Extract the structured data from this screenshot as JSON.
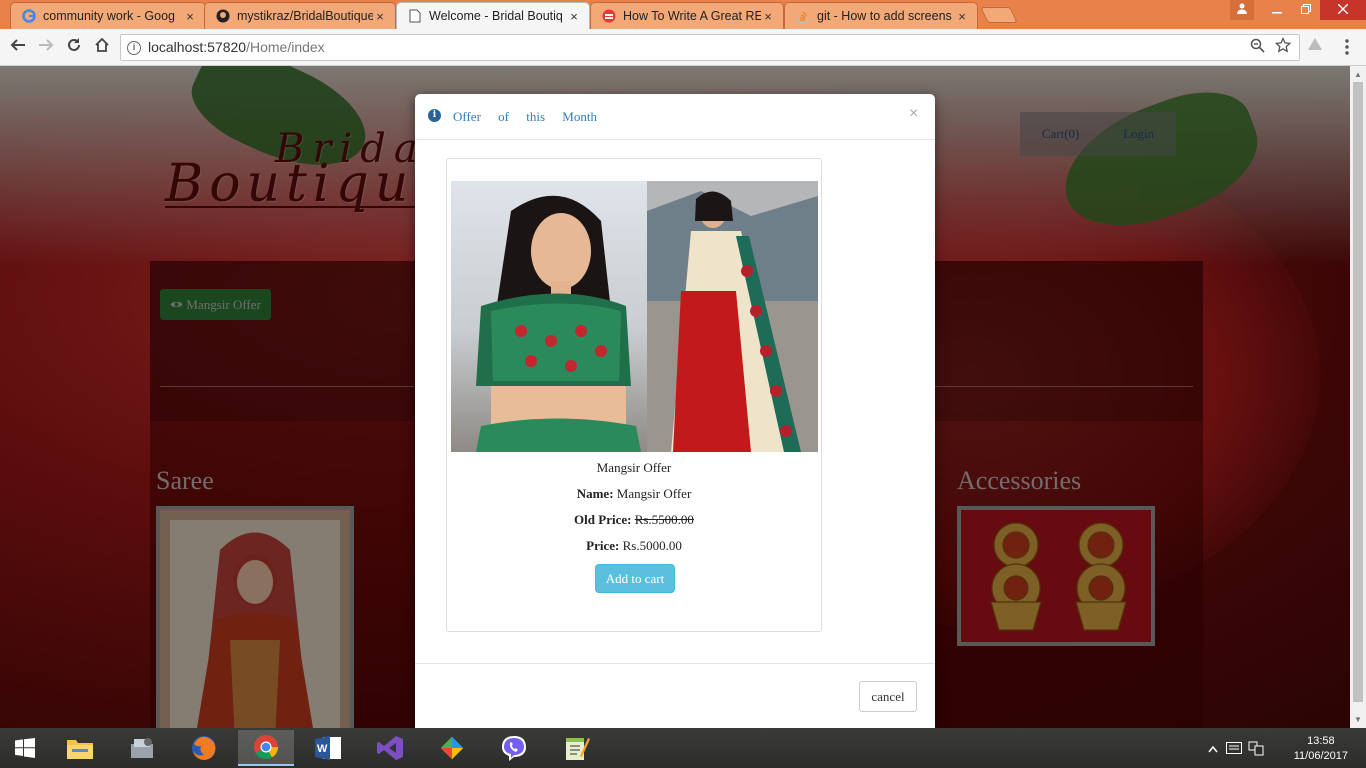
{
  "browser": {
    "tabs": [
      {
        "title": "community work - Goog",
        "icon": "google-icon"
      },
      {
        "title": "mystikraz/BridalBoutique",
        "icon": "github-icon"
      },
      {
        "title": "Welcome - Bridal Boutiq",
        "icon": "page-icon",
        "active": true
      },
      {
        "title": "How To Write A Great RE",
        "icon": "site-icon"
      },
      {
        "title": "git - How to add screens",
        "icon": "stackoverflow-icon"
      }
    ],
    "close_glyph": "×",
    "url_host": "localhost:57820",
    "url_path": "/Home/index"
  },
  "site": {
    "logo_line1": "Bridal",
    "logo_line2": "Boutique",
    "nav": {
      "cart": "Cart(0)",
      "login": "Login"
    },
    "offer_button": "Mangsir Offer",
    "categories": {
      "left": "Saree",
      "right": "Accessories"
    }
  },
  "modal": {
    "title": "Offer of this Month",
    "close": "×",
    "product": {
      "name_caption": "Mangsir Offer",
      "name_label": "Name:",
      "name_value": "Mangsir Offer",
      "old_price_label": "Old Price:",
      "old_price_value": "Rs.5500.00",
      "price_label": "Price:",
      "price_value": "Rs.5000.00"
    },
    "add_to_cart": "Add to cart",
    "cancel": "cancel"
  },
  "taskbar": {
    "time": "13:58",
    "date": "11/06/2017"
  },
  "colors": {
    "modal_link": "#337ab7",
    "offer_button_bg": "#2e7a34",
    "add_cart_bg": "#5bc0de",
    "tabstrip": "#e8824a"
  }
}
